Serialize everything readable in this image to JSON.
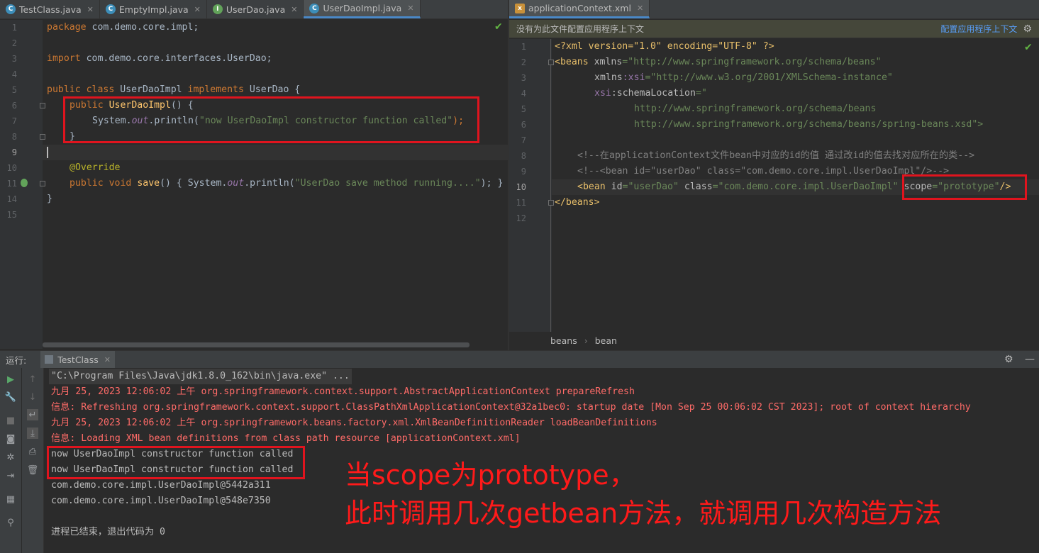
{
  "left_tabs": [
    {
      "name": "TestClass.java",
      "icon": "class-icon"
    },
    {
      "name": "EmptyImpl.java",
      "icon": "class-icon"
    },
    {
      "name": "UserDao.java",
      "icon": "interface-icon"
    },
    {
      "name": "UserDaoImpl.java",
      "icon": "class-icon",
      "active": true
    }
  ],
  "right_tab": {
    "name": "applicationContext.xml",
    "icon": "xml-icon"
  },
  "left_code": {
    "line_numbers": [
      "1",
      "2",
      "3",
      "4",
      "5",
      "6",
      "7",
      "8",
      "9",
      "10",
      "11",
      "14",
      "15"
    ],
    "l1_kw": "package",
    "l1_rest": " com.demo.core.impl;",
    "l3_kw": "import",
    "l3_rest": " com.demo.core.interfaces.UserDao;",
    "l5_kw1": "public",
    "l5_kw2": "class",
    "l5_name": " UserDaoImpl ",
    "l5_kw3": "implements",
    "l5_rest": " UserDao {",
    "l6_kw": "public",
    "l6_fn": "UserDaoImpl",
    "l6_rest": "() {",
    "l7_a": "System.",
    "l7_fld": "out",
    "l7_b": ".println(",
    "l7_str": "\"now UserDaoImpl constructor function called\"",
    "l7_c": ");",
    "l8": "}",
    "l10_ann": "@Override",
    "l11_kw1": "public",
    "l11_kw2": "void",
    "l11_fn": "save",
    "l11_a": "() { System.",
    "l11_fld": "out",
    "l11_b": ".println(",
    "l11_str": "\"UserDao save method running....\"",
    "l11_c": "); }",
    "l14": "}"
  },
  "right_code": {
    "infobar_text": "没有为此文件配置应用程序上下文",
    "infobar_link": "配置应用程序上下文",
    "line_numbers": [
      "1",
      "2",
      "3",
      "4",
      "5",
      "6",
      "7",
      "8",
      "9",
      "10",
      "11",
      "12"
    ],
    "l1": "<?xml version=\"1.0\" encoding=\"UTF-8\" ?>",
    "l2_tag": "<beans",
    "l2_attr": " xmlns",
    "l2_eq": "=",
    "l2_str": "\"http://www.springframework.org/schema/beans\"",
    "l3_attr": "xmlns",
    "l3_ns": ":xsi",
    "l3_eq": "=",
    "l3_str": "\"http://www.w3.org/2001/XMLSchema-instance\"",
    "l4_ns": "xsi",
    "l4_attr": ":schemaLocation",
    "l4_eq": "=",
    "l4_str": "\"",
    "l5_str": "http://www.springframework.org/schema/beans",
    "l6_str": "http://www.springframework.org/schema/beans/spring-beans.xsd\">",
    "l8_cmt": "<!--在applicationContext文件bean中对应的id的值 通过改id的值去找对应所在的类-->",
    "l9_cmt": "<!--<bean id=\"userDao\" class=\"com.demo.core.impl.UserDaoImpl\"/>-->",
    "l10_tag": "<bean",
    "l10_a1": " id",
    "l10_s1": "=\"userDao\"",
    "l10_a2": " class",
    "l10_s2": "=\"com.demo.core.impl.UserDaoImpl\"",
    "l10_a3": " scope",
    "l10_s3": "=\"prototype\"",
    "l10_end": "/>",
    "l11_tag": "</beans>"
  },
  "breadcrumb": [
    "beans",
    "bean"
  ],
  "run_panel": {
    "label": "运行:",
    "tab": "TestClass",
    "lines": [
      {
        "text": "\"C:\\Program Files\\Java\\jdk1.8.0_162\\bin\\java.exe\" ...",
        "kind": "cmd"
      },
      {
        "text": "九月 25, 2023 12:06:02 上午 org.springframework.context.support.AbstractApplicationContext prepareRefresh",
        "kind": "err"
      },
      {
        "text": "信息: Refreshing org.springframework.context.support.ClassPathXmlApplicationContext@32a1bec0: startup date [Mon Sep 25 00:06:02 CST 2023]; root of context hierarchy",
        "kind": "err"
      },
      {
        "text": "九月 25, 2023 12:06:02 上午 org.springframework.beans.factory.xml.XmlBeanDefinitionReader loadBeanDefinitions",
        "kind": "err"
      },
      {
        "text": "信息: Loading XML bean definitions from class path resource [applicationContext.xml]",
        "kind": "err"
      },
      {
        "text": "now UserDaoImpl constructor function called",
        "kind": "out"
      },
      {
        "text": "now UserDaoImpl constructor function called",
        "kind": "out"
      },
      {
        "text": "com.demo.core.impl.UserDaoImpl@5442a311",
        "kind": "out"
      },
      {
        "text": "com.demo.core.impl.UserDaoImpl@548e7350",
        "kind": "out"
      },
      {
        "text": "",
        "kind": "out"
      },
      {
        "text": "进程已结束，退出代码为 0",
        "kind": "out"
      }
    ]
  },
  "annotation": {
    "line1": "当scope为prototype，",
    "line2": "此时调用几次getbean方法，就调用几次构造方法"
  },
  "colors": {
    "highlight_box": "#e0141e",
    "annotation_text": "#ff1a1a"
  }
}
